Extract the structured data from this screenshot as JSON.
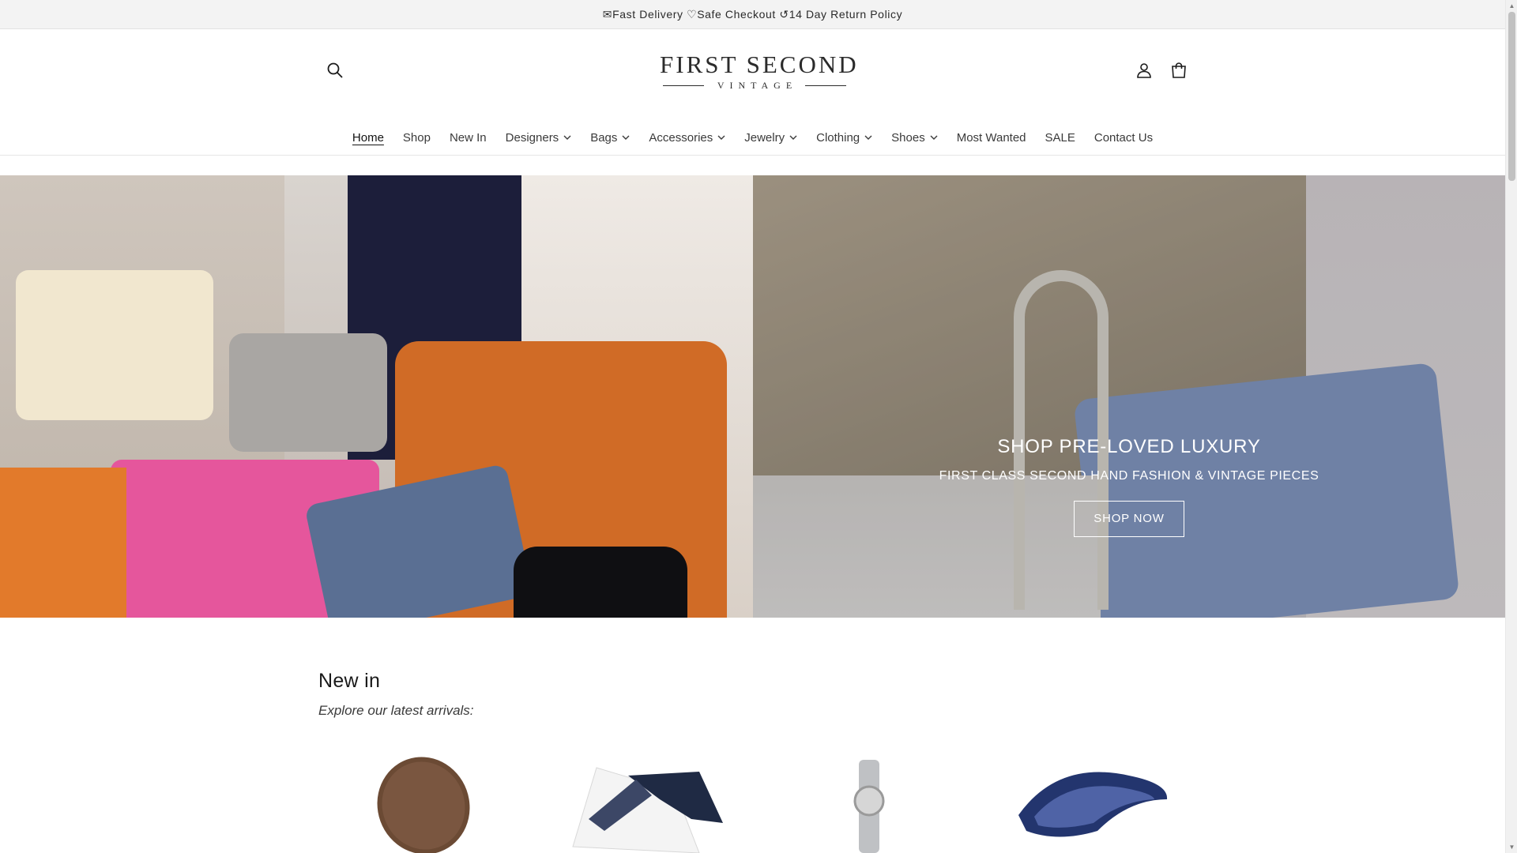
{
  "announcement": {
    "text": "✉Fast Delivery ♡Safe Checkout ↺14 Day Return Policy"
  },
  "header": {
    "logo_main": "FIRST SECOND",
    "logo_sub": "VINTAGE"
  },
  "nav": {
    "items": [
      {
        "label": "Home",
        "active": true,
        "dropdown": false
      },
      {
        "label": "Shop",
        "dropdown": false
      },
      {
        "label": "New In",
        "dropdown": false
      },
      {
        "label": "Designers",
        "dropdown": true
      },
      {
        "label": "Bags",
        "dropdown": true
      },
      {
        "label": "Accessories",
        "dropdown": true
      },
      {
        "label": "Jewelry",
        "dropdown": true
      },
      {
        "label": "Clothing",
        "dropdown": true
      },
      {
        "label": "Shoes",
        "dropdown": true
      },
      {
        "label": "Most Wanted",
        "dropdown": false
      },
      {
        "label": "SALE",
        "dropdown": false
      },
      {
        "label": "Contact Us",
        "dropdown": false
      }
    ]
  },
  "hero": {
    "title": "SHOP PRE-LOVED LUXURY",
    "subtitle": "FIRST CLASS SECOND HAND FASHION & VINTAGE PIECES",
    "button": "SHOP NOW"
  },
  "new_in": {
    "title": "New in",
    "subtitle": "Explore our latest arrivals:"
  },
  "icons": {
    "search": "search-icon",
    "account": "account-icon",
    "cart": "cart-icon"
  }
}
